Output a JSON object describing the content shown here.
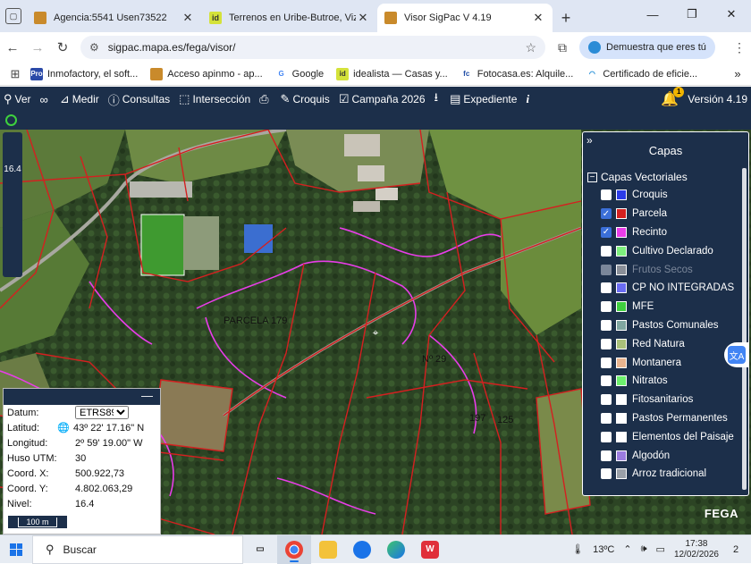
{
  "browser": {
    "tabs": [
      {
        "title": "Agencia:5541 Usen73522",
        "favicon_color": "#c98a2b",
        "favicon_text": ""
      },
      {
        "title": "Terrenos en Uribe-Butroe, Vizca",
        "favicon_color": "#d4e23a",
        "favicon_text": "id"
      },
      {
        "title": "Visor SigPac V 4.19",
        "favicon_color": "#c98a2b",
        "favicon_text": ""
      }
    ],
    "new_tab": "+",
    "window_controls": {
      "minimize": "—",
      "maximize": "❐",
      "close": "✕"
    },
    "url": "sigpac.mapa.es/fega/visor/",
    "profile_label": "Demuestra que eres tú",
    "bookmarks": [
      {
        "label": "Inmofactory, el soft...",
        "color": "#2b4aa8",
        "text": "Pro"
      },
      {
        "label": "Acceso apinmo - ap...",
        "color": "#c98a2b",
        "text": ""
      },
      {
        "label": "Google",
        "color": "#ffffff",
        "text": "G"
      },
      {
        "label": "idealista — Casas y...",
        "color": "#d4e23a",
        "text": "id"
      },
      {
        "label": "Fotocasa.es: Alquile...",
        "color": "#ffffff",
        "text": "fc"
      },
      {
        "label": "Certificado de eficie...",
        "color": "#ffffff",
        "text": ""
      }
    ],
    "bookmarks_more": "»"
  },
  "toolbar": {
    "items": [
      {
        "icon": "search-icon",
        "glyph": "🔍",
        "label": "Ver"
      },
      {
        "icon": "binoculars-icon",
        "glyph": "👁",
        "label": ""
      },
      {
        "icon": "ruler-icon",
        "glyph": "📐",
        "label": "Medir"
      },
      {
        "icon": "info-icon",
        "glyph": "ⓘ",
        "label": "Consultas"
      },
      {
        "icon": "intersection-icon",
        "glyph": "⬚",
        "label": "Intersección"
      },
      {
        "icon": "print-icon",
        "glyph": "🖶",
        "label": ""
      },
      {
        "icon": "pencil-icon",
        "glyph": "✎",
        "label": "Croquis"
      },
      {
        "icon": "calendar-check-icon",
        "glyph": "☑",
        "label": "Campaña 2026"
      },
      {
        "icon": "download-icon",
        "glyph": "⭳",
        "label": ""
      },
      {
        "icon": "folder-icon",
        "glyph": "▤",
        "label": "Expediente"
      },
      {
        "icon": "info-italic-icon",
        "glyph": "i",
        "label": ""
      }
    ],
    "bell_badge": "1",
    "version": "Versión 4.19"
  },
  "map": {
    "zoom_level": "16.4",
    "labels": [
      {
        "text": "PARCELA 179"
      },
      {
        "text": "Nº 29"
      },
      {
        "text": "197"
      },
      {
        "text": "125"
      }
    ],
    "watermark": "FEGA"
  },
  "layers": {
    "title": "Capas",
    "collapse": "»",
    "group_label": "Capas Vectoriales",
    "group_toggle": "−",
    "items": [
      {
        "label": "Croquis",
        "checked": false,
        "swatch": "#2a3be8",
        "dim": false
      },
      {
        "label": "Parcela",
        "checked": true,
        "swatch": "#d42020",
        "dim": false
      },
      {
        "label": "Recinto",
        "checked": true,
        "swatch": "#e83de8",
        "dim": false
      },
      {
        "label": "Cultivo Declarado",
        "checked": false,
        "swatch": "#7ef07e",
        "dim": false
      },
      {
        "label": "Frutos Secos",
        "checked": false,
        "swatch": "#8a8f98",
        "dim": true
      },
      {
        "label": "CP NO INTEGRADAS",
        "checked": false,
        "swatch": "#6a6cf2",
        "dim": false
      },
      {
        "label": "MFE",
        "checked": false,
        "swatch": "#3fcf3f",
        "dim": false
      },
      {
        "label": "Pastos Comunales",
        "checked": false,
        "swatch": "#7fa6a0",
        "dim": false
      },
      {
        "label": "Red Natura",
        "checked": false,
        "swatch": "#a9c07a",
        "dim": false
      },
      {
        "label": "Montanera",
        "checked": false,
        "swatch": "#e8b48f",
        "dim": false
      },
      {
        "label": "Nitratos",
        "checked": false,
        "swatch": "#6df06d",
        "dim": false
      },
      {
        "label": "Fitosanitarios",
        "checked": false,
        "swatch": "#ffffff",
        "dim": false
      },
      {
        "label": "Pastos Permanentes",
        "checked": false,
        "swatch": "#ffffff",
        "dim": false
      },
      {
        "label": "Elementos del Paisaje",
        "checked": false,
        "swatch": "#ffffff",
        "dim": false
      },
      {
        "label": "Algodón",
        "checked": false,
        "swatch": "#9b7ce0",
        "dim": false
      },
      {
        "label": "Arroz tradicional",
        "checked": false,
        "swatch": "#9aa0a8",
        "dim": false
      }
    ]
  },
  "coords": {
    "minimize": "—",
    "rows": [
      {
        "key": "Datum:",
        "value": "ETRS89"
      },
      {
        "key": "Latitud:",
        "value": "43º 22' 17.16\" N"
      },
      {
        "key": "Longitud:",
        "value": "2º 59' 19.00\" W"
      },
      {
        "key": "Huso UTM:",
        "value": "30"
      },
      {
        "key": "Coord. X:",
        "value": "500.922,73"
      },
      {
        "key": "Coord. Y:",
        "value": "4.802.063,29"
      },
      {
        "key": "Nivel:",
        "value": "16.4"
      }
    ],
    "scale": "100 m"
  },
  "taskbar": {
    "search_placeholder": "Buscar",
    "weather": "13ºC",
    "time": "17:38",
    "date": "12/02/2026",
    "notifications": "2"
  },
  "colors": {
    "accent_dark": "#1c2f4a",
    "parcel_line": "#d42020",
    "recinto_line": "#e83de8"
  }
}
